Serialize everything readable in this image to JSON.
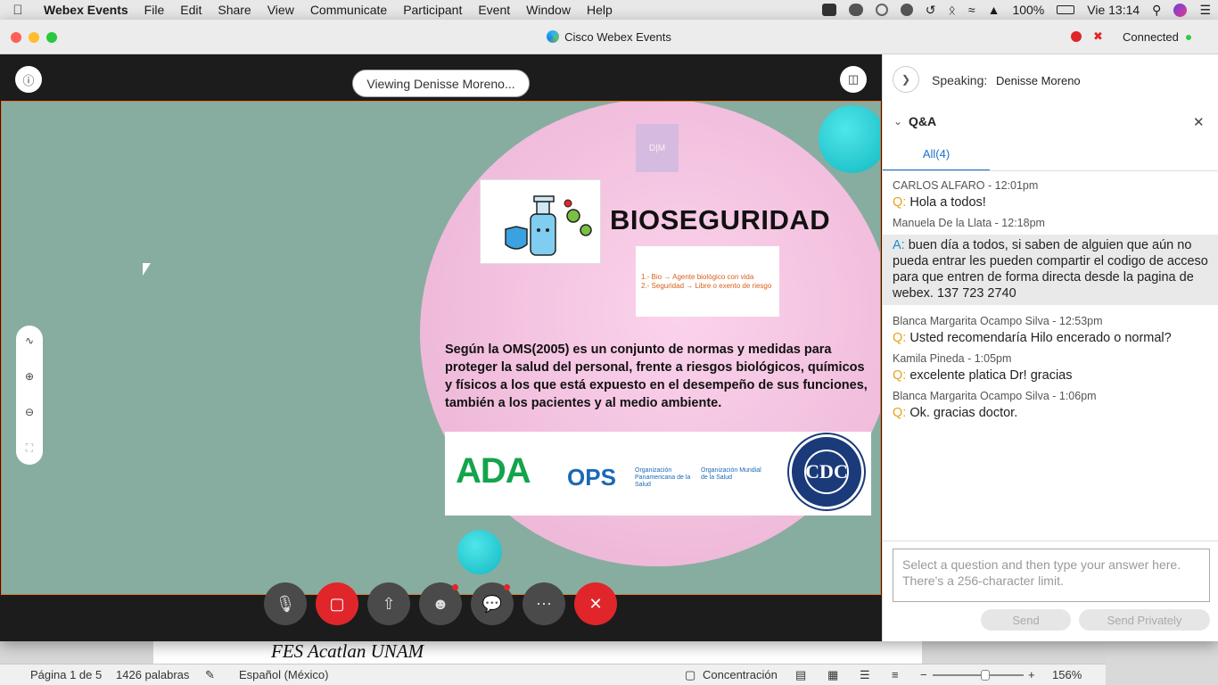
{
  "menubar": {
    "app_name": "Webex Events",
    "items": [
      "File",
      "Edit",
      "Share",
      "View",
      "Communicate",
      "Participant",
      "Event",
      "Window",
      "Help"
    ],
    "battery": "100%",
    "clock": "Vie 13:14"
  },
  "window": {
    "title": "Cisco Webex Events",
    "status": "Connected"
  },
  "stage": {
    "viewing_label": "Viewing Denisse Moreno..."
  },
  "slide": {
    "watermark": "D|M",
    "title": "BIOSEGURIDAD",
    "definition_1": "1.- Bio → Agente biológico con vida",
    "definition_2": "2.- Seguridad → Libre o exento de riesgo",
    "body": "Según la OMS(2005) es un conjunto de normas y medidas para proteger la salud del personal, frente a riesgos biológicos, químicos y físicos a los que está expuesto en el desempeño de sus funciones, también a los pacientes y al medio ambiente.",
    "logo_ada": "ADA",
    "logo_ops": "OPS",
    "logo_ops_sub": "Organización Panamericana de la Salud",
    "logo_oms_sub": "Organización Mundial de la Salud",
    "logo_cdc": "CDC"
  },
  "panel": {
    "speaking_label": "Speaking:",
    "speaker_name": "Denisse Moreno",
    "qa_title": "Q&A",
    "tab_all": "All(4)",
    "entries": [
      {
        "meta": "CARLOS ALFARO - 12:01pm",
        "prefix": "Q:",
        "text": "Hola a todos!"
      },
      {
        "meta": "Manuela De la Llata - 12:18pm",
        "prefix": "A:",
        "text": "buen día a todos, si saben de alguien que aún no pueda entrar les pueden compartir el codigo de acceso para que entren de forma directa desde la pagina de webex. 137 723 2740"
      },
      {
        "meta": "Blanca Margarita Ocampo Silva - 12:53pm",
        "prefix": "Q:",
        "text": "Usted recomendaría Hilo encerado o normal?"
      },
      {
        "meta": "Kamila Pineda - 1:05pm",
        "prefix": "Q:",
        "text": "excelente platica Dr! gracias"
      },
      {
        "meta": "Blanca Margarita Ocampo Silva - 1:06pm",
        "prefix": "Q:",
        "text": "Ok. gracias doctor."
      }
    ],
    "answer_placeholder": "Select a question and then type your answer here. There's a 256-character limit.",
    "send_label": "Send",
    "send_privately_label": "Send Privately"
  },
  "word": {
    "doc_text": "FES Acatlan UNAM",
    "page_info": "Página 1 de 5",
    "word_count": "1426 palabras",
    "language": "Español (México)",
    "focus": "Concentración",
    "zoom": "156%"
  },
  "colors": {
    "accent_blue": "#1a6fd1",
    "end_red": "#e0262a",
    "question_orange": "#e8a21a",
    "share_border": "#e57a2e"
  }
}
